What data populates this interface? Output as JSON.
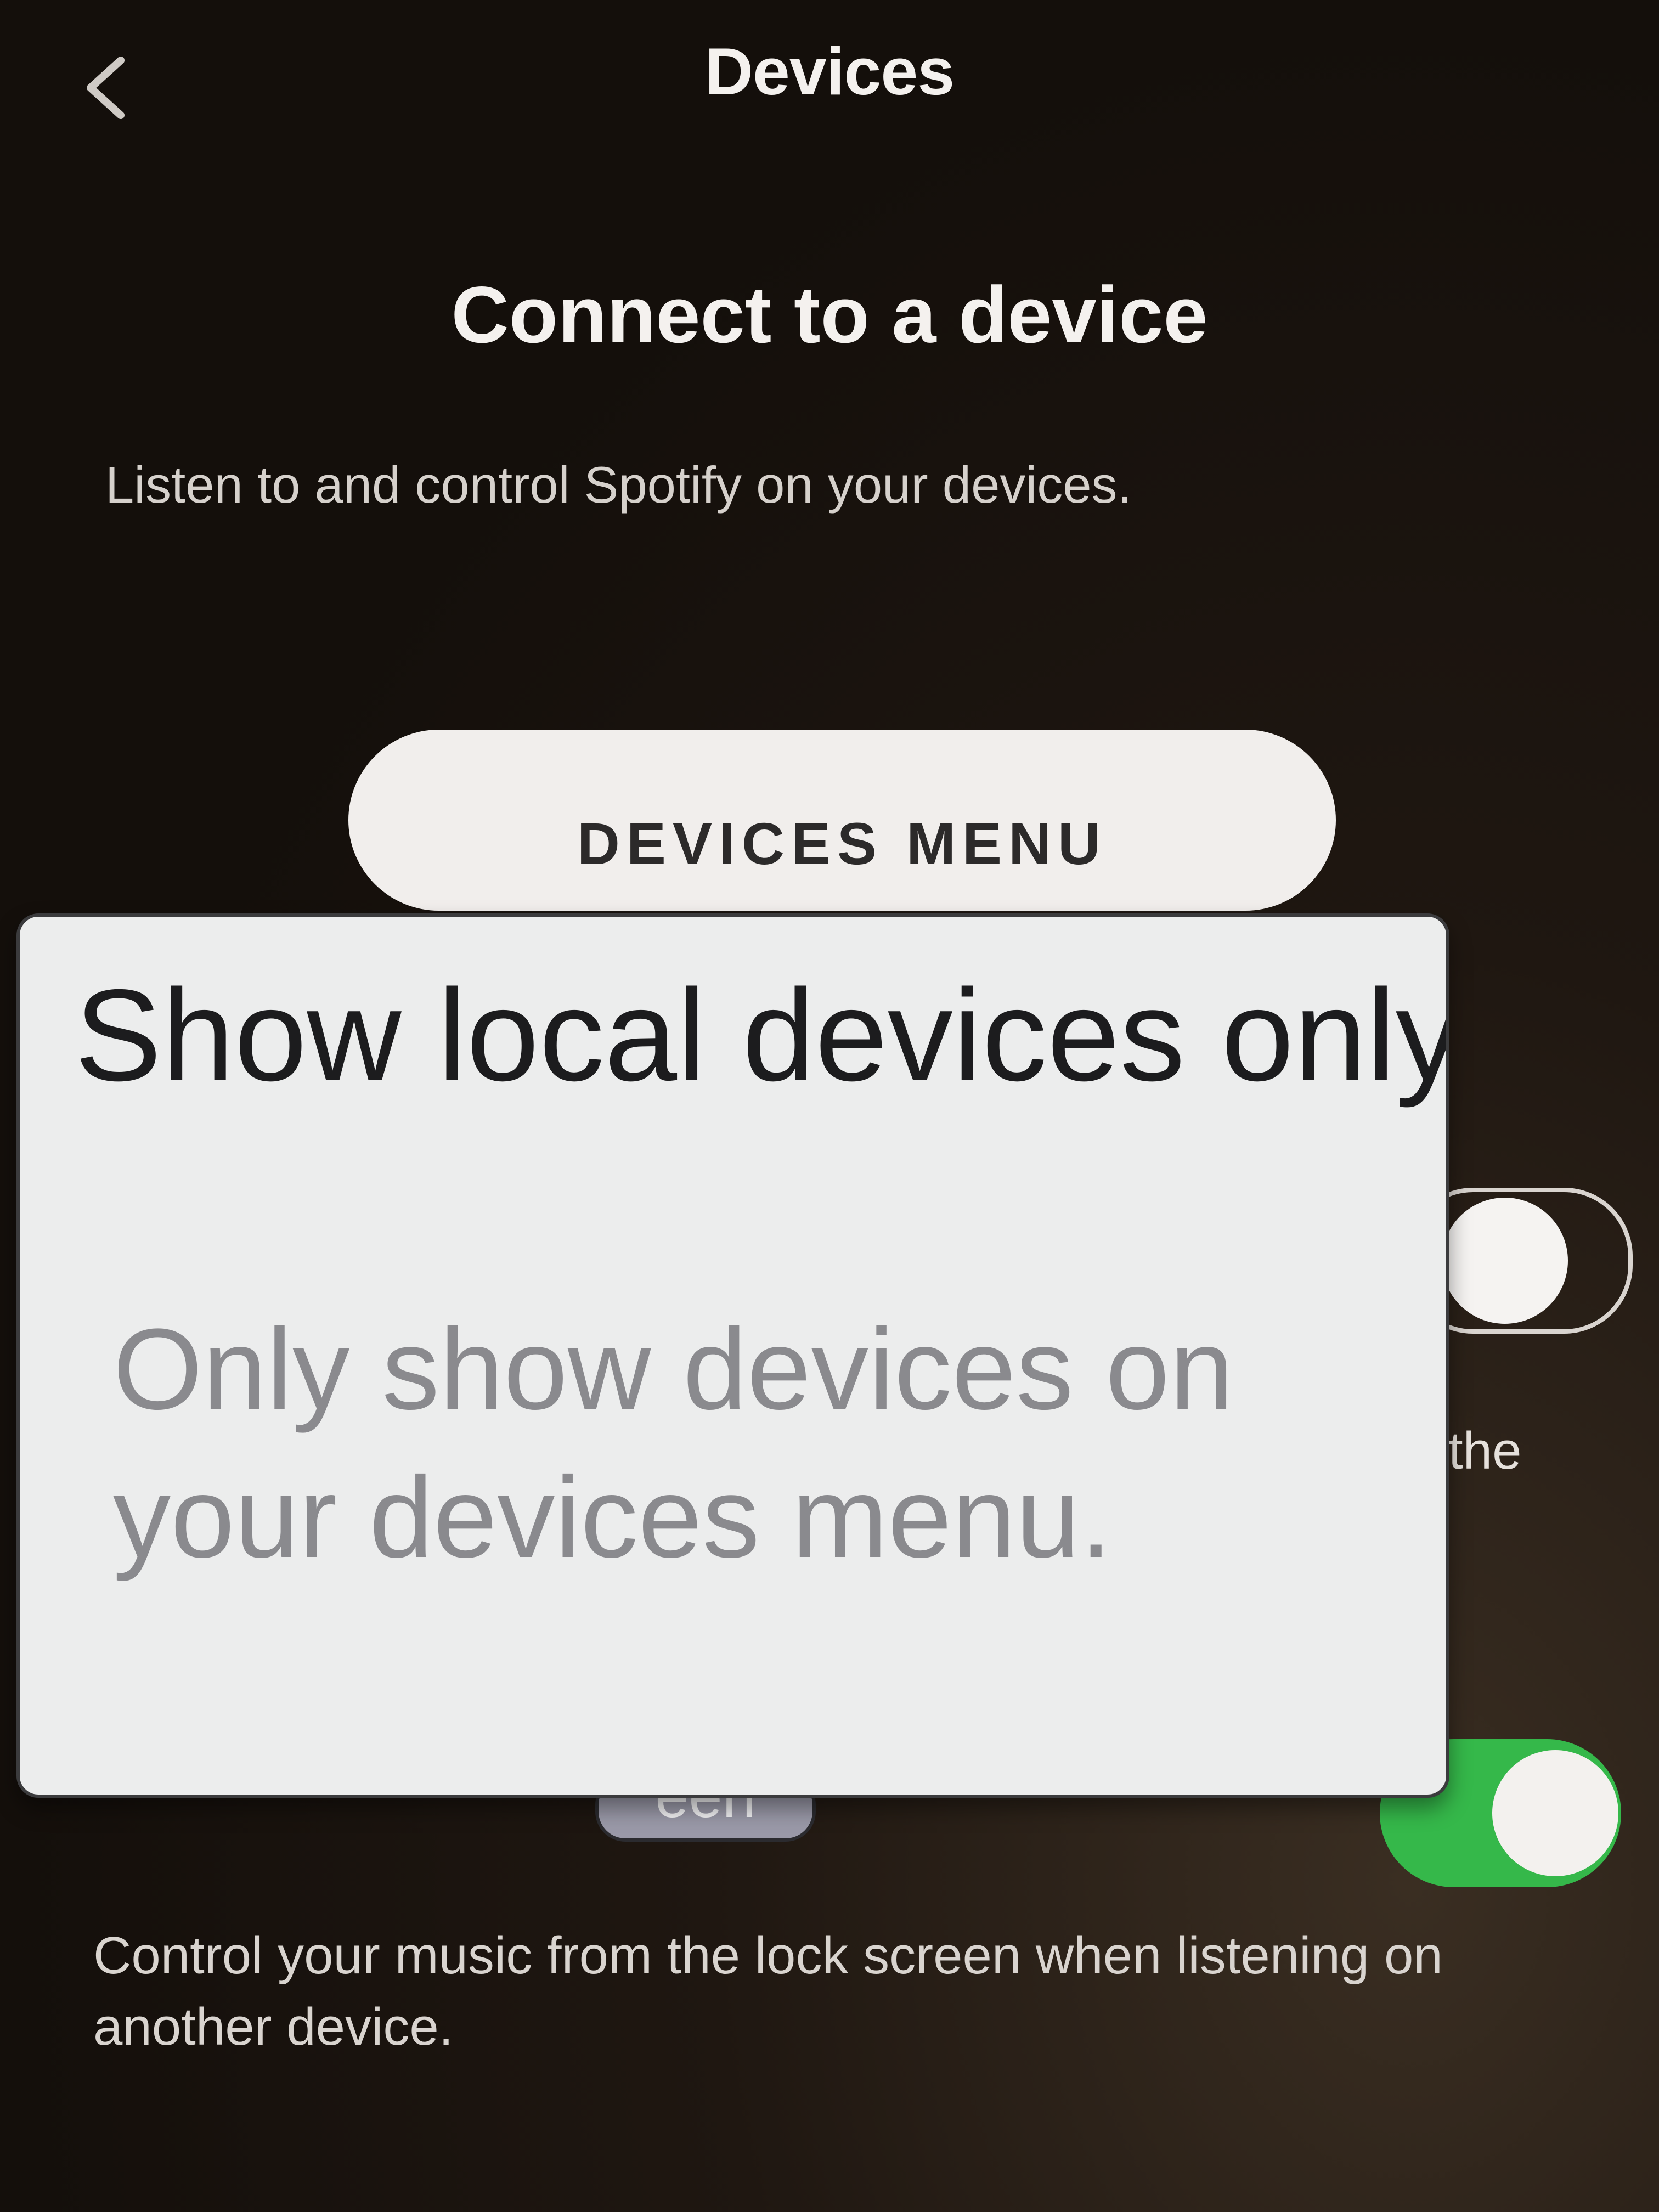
{
  "header": {
    "title": "Devices",
    "back_icon": "chevron-left-icon"
  },
  "main": {
    "heading": "Connect to a device",
    "subtext": "Listen to and control Spotify on your devices.",
    "devices_menu_button": "DEVICES MENU",
    "obscured_fragment": "the",
    "local_devices_toggle": {
      "on": false
    },
    "lock_screen_toggle": {
      "on": true
    },
    "lock_screen_description": "Control your music from the lock screen when listening on another device."
  },
  "tooltip": {
    "title": "Show local devices only",
    "description": "Only show devices on your devices menu.",
    "tab_label": "een"
  },
  "colors": {
    "accent_green": "#35b84a",
    "background": "#140f0b",
    "tooltip_bg": "#eceded"
  }
}
